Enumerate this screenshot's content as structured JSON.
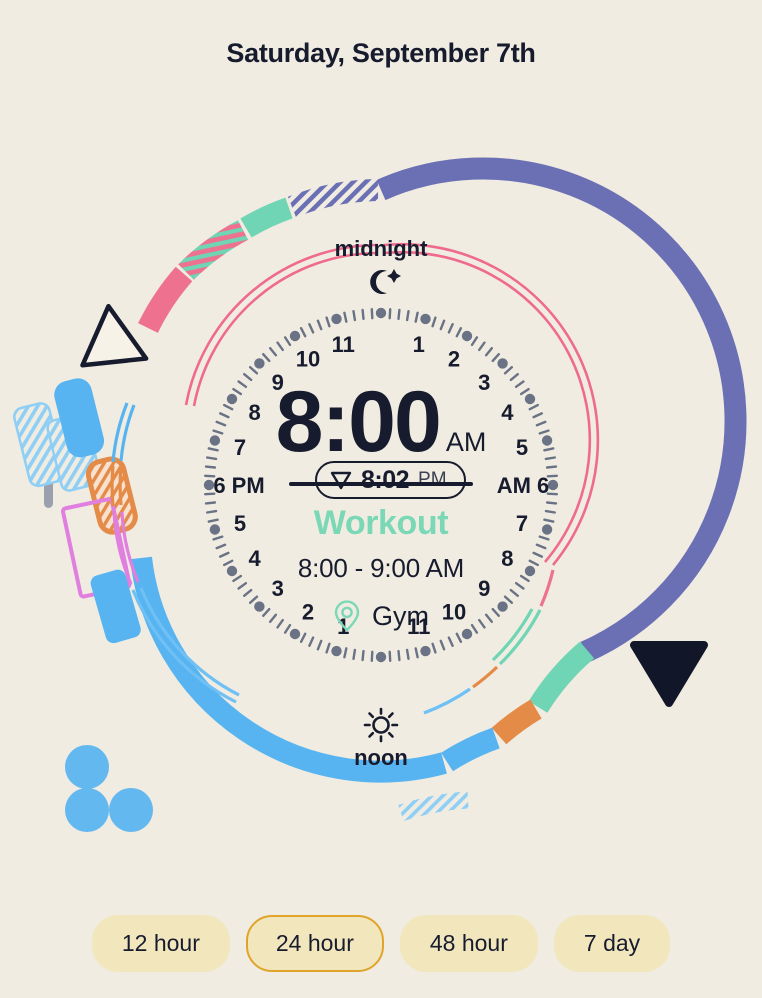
{
  "header": {
    "title": "Saturday, September 7th"
  },
  "now_pill": {
    "icon": "triangle-down-icon",
    "time": "8:02",
    "suffix": "PM"
  },
  "center": {
    "time": "8:00",
    "time_suffix": "AM",
    "event_title": "Workout",
    "event_time": "8:00 - 9:00 AM",
    "location_icon": "map-pin-icon",
    "location": "Gym"
  },
  "clock_face": {
    "midnight_label": "midnight",
    "midnight_icon": "moon-star-icon",
    "noon_label": "noon",
    "noon_icon": "sun-icon",
    "left_label": "6 PM",
    "right_label": "AM 6",
    "hour_numbers_right_side": [
      "1",
      "2",
      "3",
      "4",
      "5",
      "7",
      "8",
      "9",
      "10",
      "11"
    ],
    "hour_numbers_left_side": [
      "1",
      "2",
      "3",
      "4",
      "5",
      "7",
      "8",
      "9",
      "10",
      "11"
    ],
    "hour_dot_color": "#6a7285",
    "tick_color": "#6a7285",
    "inner_line_color": "#ef6b8e"
  },
  "colors": {
    "background": "#f0ece1",
    "ink": "#171b2e",
    "teal": "#7bd8b6",
    "purple": "#6b70b5",
    "pink": "#ee7190",
    "blue": "#57b4f0",
    "orange": "#e58b48",
    "magenta": "#e07fe0",
    "tab_fill": "#f2e6bd",
    "tab_selected_border": "#e0a42a"
  },
  "markers": {
    "outline_triangle": "triangle-outline-marker",
    "filled_triangle": "triangle-filled-marker",
    "dots_cluster": "three-dots-cluster"
  },
  "range_tabs": [
    {
      "label": "12 hour",
      "selected": false
    },
    {
      "label": "24 hour",
      "selected": true
    },
    {
      "label": "48 hour",
      "selected": false
    },
    {
      "label": "7 day",
      "selected": false
    }
  ]
}
